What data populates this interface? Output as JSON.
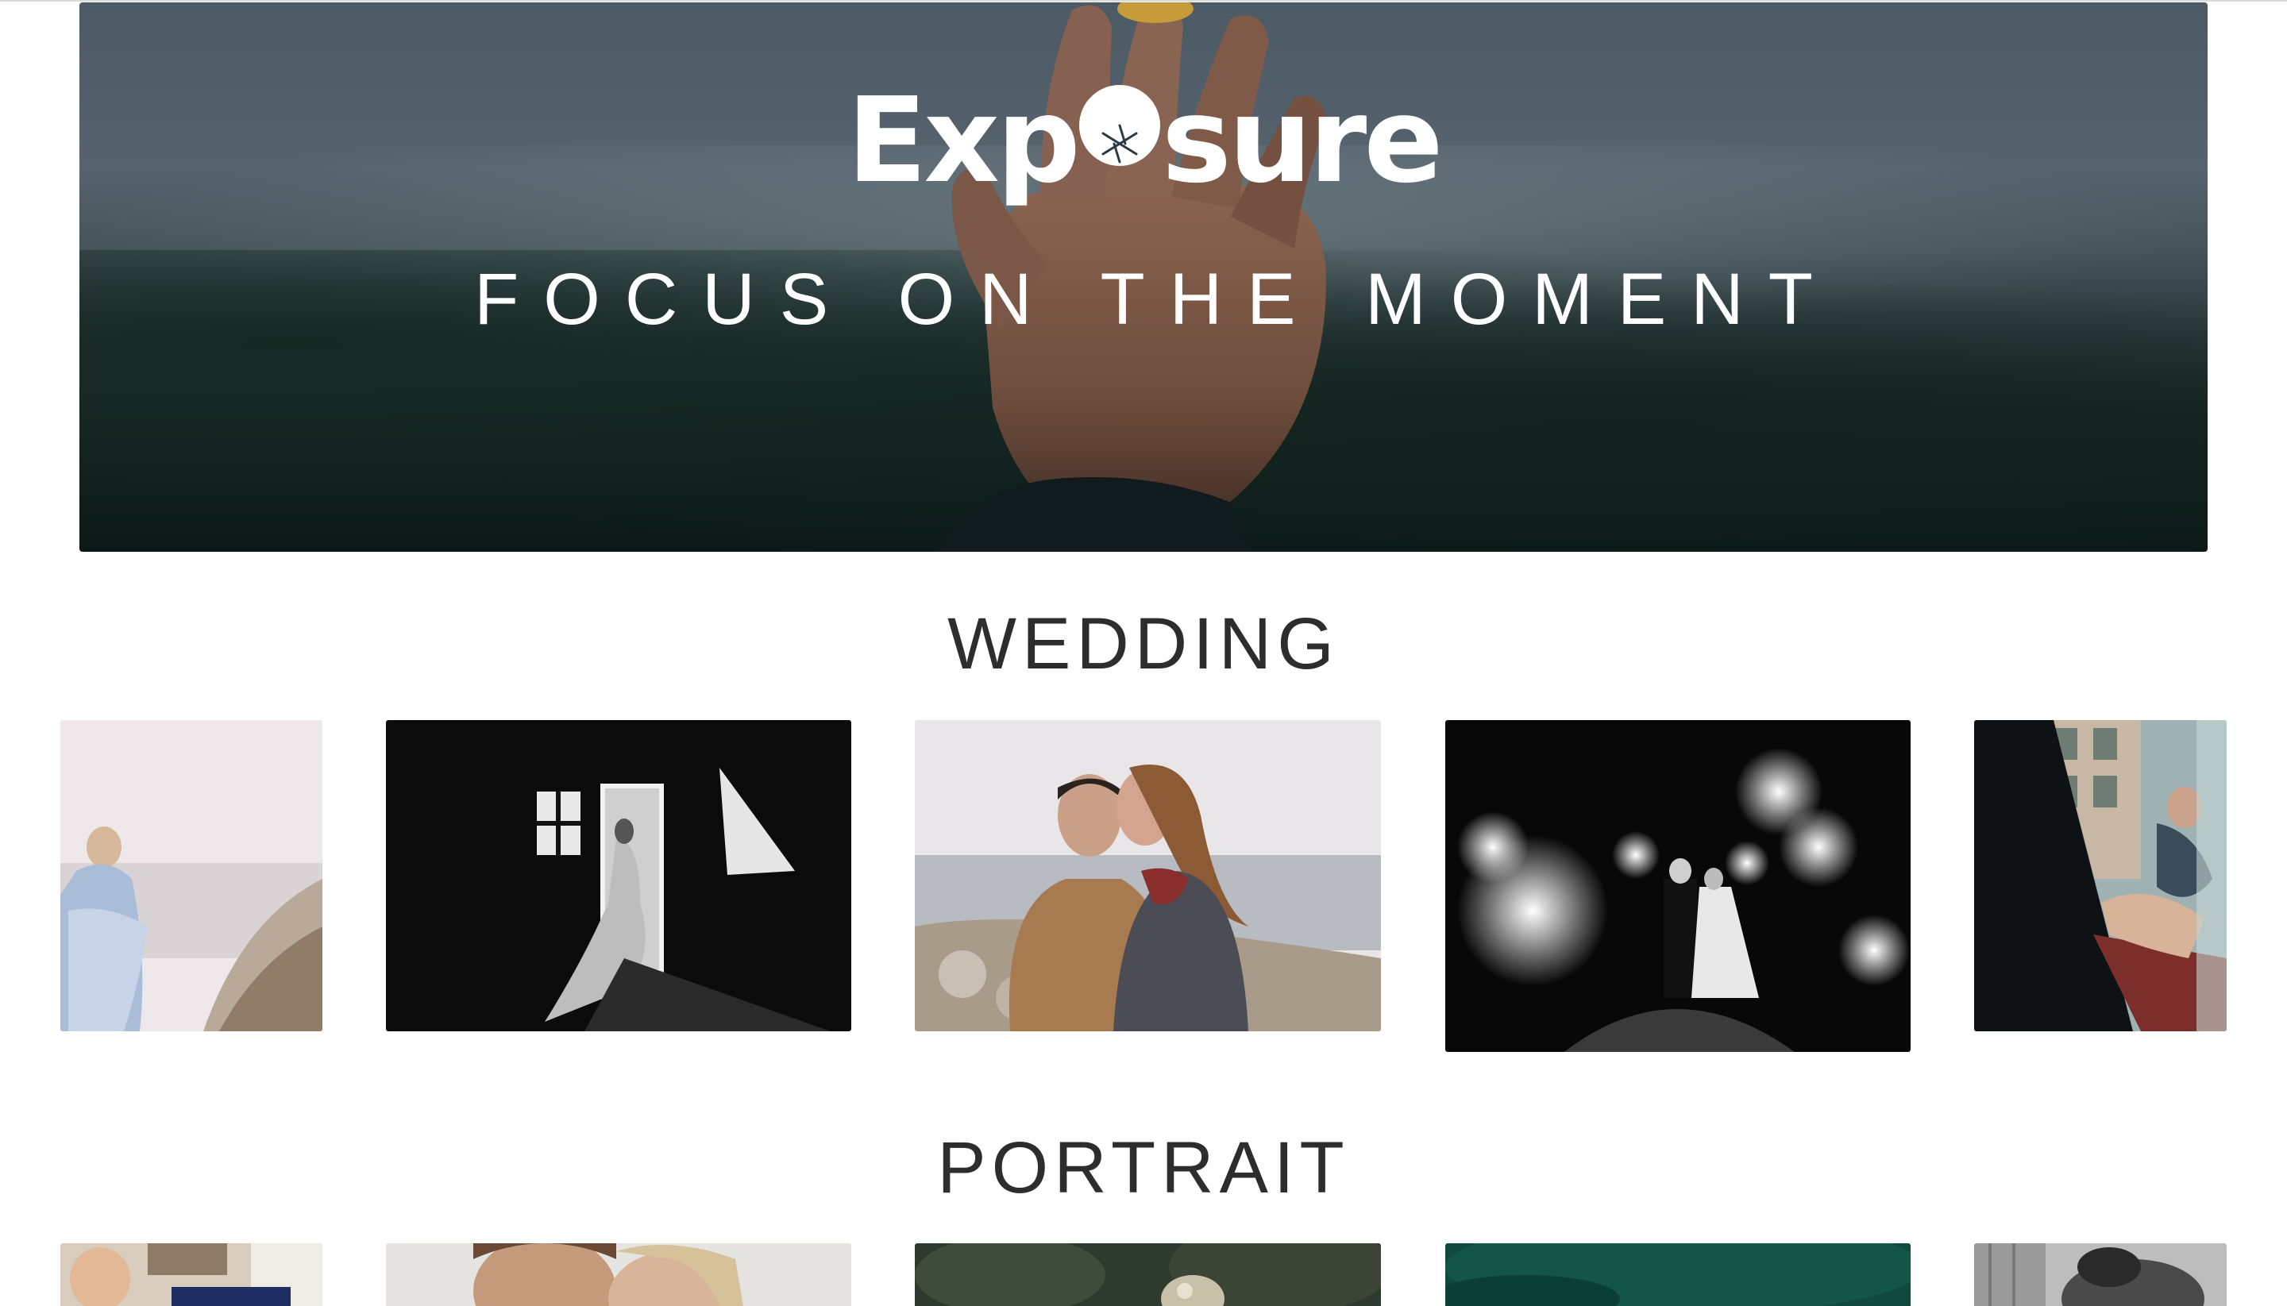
{
  "hero": {
    "brand": {
      "text_before": "Exp",
      "text_after": "sure"
    },
    "tagline": "FOCUS ON THE MOMENT"
  },
  "sections": [
    {
      "title": "WEDDING",
      "photos": [
        {
          "subject": "bride-on-beach-photo"
        },
        {
          "subject": "bride-at-window-photo"
        },
        {
          "subject": "couple-embrace-photo"
        },
        {
          "subject": "sparkler-exit-photo"
        },
        {
          "subject": "couple-balcony-photo"
        }
      ]
    },
    {
      "title": "PORTRAIT",
      "photos": [
        {
          "subject": "child-portrait-photo"
        },
        {
          "subject": "couple-portrait-photo"
        },
        {
          "subject": "outdoor-portrait-photo"
        },
        {
          "subject": "green-portrait-photo"
        },
        {
          "subject": "monochrome-portrait-photo"
        }
      ]
    }
  ],
  "colors": {
    "heading": "#2d2d2d",
    "background": "#ffffff",
    "hero_overlay": "#4c5a66"
  }
}
